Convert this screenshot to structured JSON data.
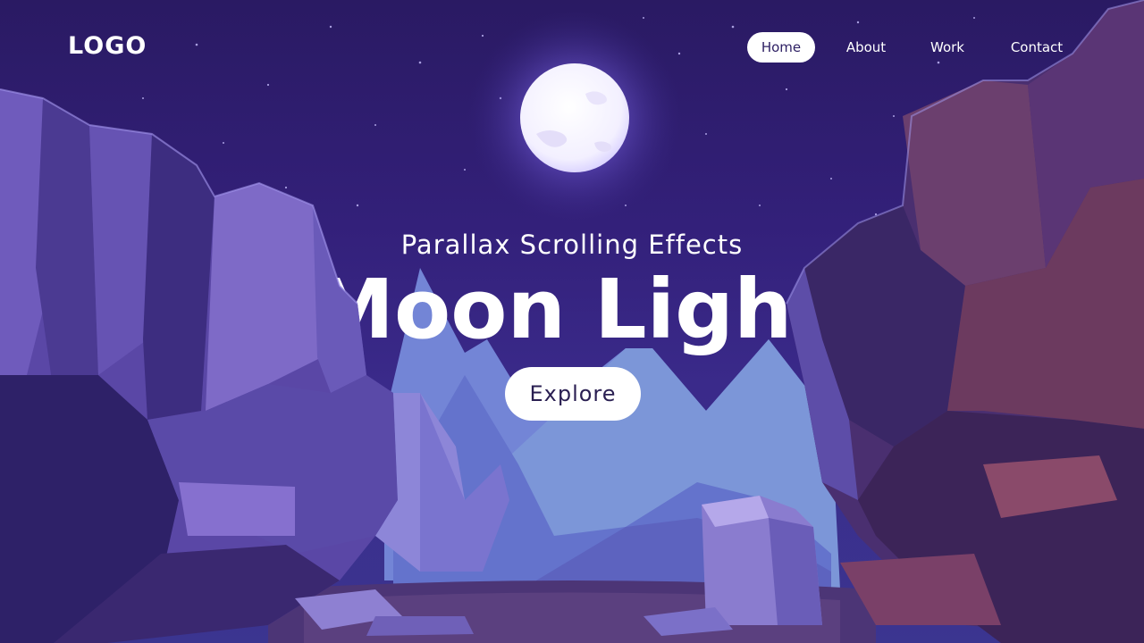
{
  "header": {
    "logo": "LOGO",
    "nav": [
      {
        "label": "Home",
        "active": true
      },
      {
        "label": "About",
        "active": false
      },
      {
        "label": "Work",
        "active": false
      },
      {
        "label": "Contact",
        "active": false
      }
    ]
  },
  "hero": {
    "subtitle": "Parallax Scrolling Effects",
    "title": "Moon Light",
    "button_label": "Explore"
  },
  "colors": {
    "sky_top": "#2a1a63",
    "sky_bottom": "#3b3590",
    "moon": "#ffffff",
    "moon_glow": "#8f7dff",
    "mountain_light": "#7d8fd8",
    "mountain_mid": "#5c6bc8",
    "rock_left": "#6a56b3",
    "rock_dark": "#2a1c55",
    "rock_right": "#4a2f6e",
    "ground": "#3d2a63",
    "text": "#ffffff",
    "button_text": "#2a1f52"
  },
  "icons": {
    "moon": "full-moon-icon"
  }
}
